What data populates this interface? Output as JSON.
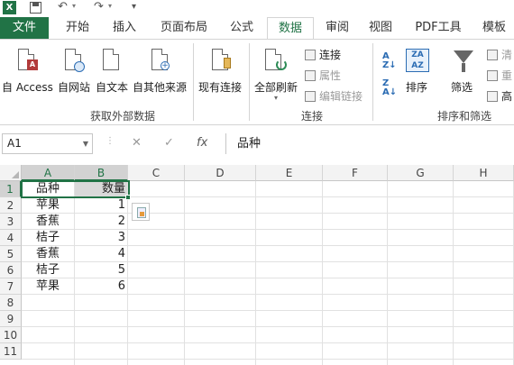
{
  "qat": {
    "app_letter": "X",
    "undo": "↶",
    "redo": "↷",
    "dropdown": "▾"
  },
  "tabs": [
    {
      "label": "文件"
    },
    {
      "label": "开始"
    },
    {
      "label": "插入"
    },
    {
      "label": "页面布局"
    },
    {
      "label": "公式"
    },
    {
      "label": "数据"
    },
    {
      "label": "审阅"
    },
    {
      "label": "视图"
    },
    {
      "label": "PDF工具"
    },
    {
      "label": "模板"
    }
  ],
  "active_tab": "数据",
  "ribbon": {
    "get_external": {
      "from_access": "自 Access",
      "from_web": "自网站",
      "from_text": "自文本",
      "from_other": "自其他来源",
      "existing": "现有连接",
      "group_label": "获取外部数据"
    },
    "connections": {
      "refresh_all": "全部刷新",
      "connections": "连接",
      "properties": "属性",
      "edit_links": "编辑链接",
      "group_label": "连接"
    },
    "sort_filter": {
      "sort": "排序",
      "filter": "筛选",
      "clear": "清",
      "reapply": "重",
      "advanced": "高",
      "group_label": "排序和筛选"
    }
  },
  "formula_bar": {
    "name_box": "A1",
    "cancel": "✕",
    "enter": "✓",
    "fx": "fx",
    "content": "品种"
  },
  "sheet": {
    "columns": [
      "A",
      "B",
      "C",
      "D",
      "E",
      "F",
      "G",
      "H"
    ],
    "rows": [
      "1",
      "2",
      "3",
      "4",
      "5",
      "6",
      "7",
      "8",
      "9",
      "10",
      "11"
    ],
    "data": [
      {
        "a": "品种",
        "b": "数量"
      },
      {
        "a": "苹果",
        "b": "1"
      },
      {
        "a": "香蕉",
        "b": "2"
      },
      {
        "a": "桔子",
        "b": "3"
      },
      {
        "a": "香蕉",
        "b": "4"
      },
      {
        "a": "桔子",
        "b": "5"
      },
      {
        "a": "苹果",
        "b": "6"
      }
    ]
  },
  "colors": {
    "accent": "#217346",
    "header_bg": "#f3f3f3",
    "selected_header_bg": "#d2d2d2"
  }
}
